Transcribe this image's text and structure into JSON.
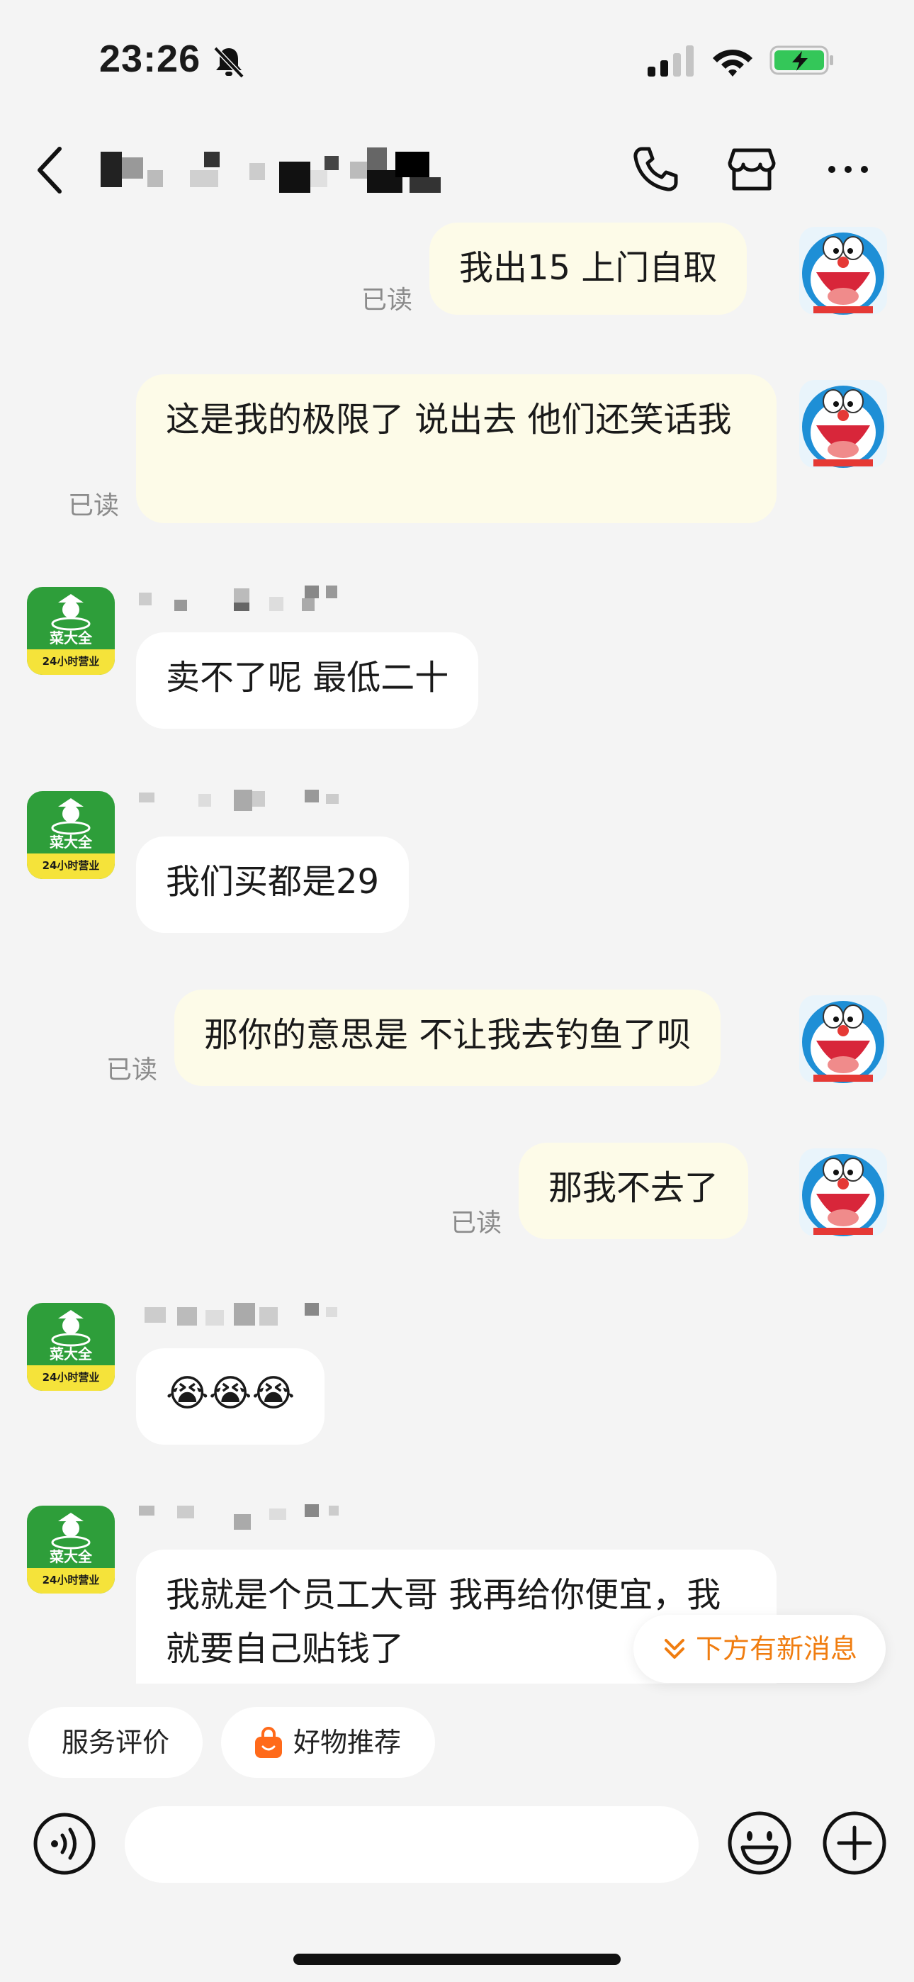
{
  "status_bar": {
    "time": "23:26"
  },
  "header": {
    "title_blurred": true
  },
  "messages": [
    {
      "side": "me",
      "text": "我出15 上门自取",
      "read": "已读"
    },
    {
      "side": "me",
      "text": "这是我的极限了 说出去 他们还笑话我",
      "read": "已读"
    },
    {
      "side": "them",
      "text": "卖不了呢 最低二十"
    },
    {
      "side": "them",
      "text": "我们买都是29"
    },
    {
      "side": "me",
      "text": "那你的意思是 不让我去钓鱼了呗",
      "read": "已读"
    },
    {
      "side": "me",
      "text": "那我不去了",
      "read": "已读"
    },
    {
      "side": "them",
      "text": "😭😭😭"
    },
    {
      "side": "them",
      "text": "我就是个员工大哥 我再给你便宜，我就要自己贴钱了"
    }
  ],
  "shop_avatar": {
    "line1": "菜大全",
    "line2": "24小时营业"
  },
  "new_message_pill": "下方有新消息",
  "quick_actions": {
    "service_review": "服务评价",
    "good_recommend": "好物推荐"
  },
  "colors": {
    "my_bubble": "#fdfbe8",
    "their_bubble": "#ffffff",
    "accent_orange": "#f07d10",
    "shop_green": "#2e9e3a",
    "shop_yellow": "#f5e33a"
  }
}
